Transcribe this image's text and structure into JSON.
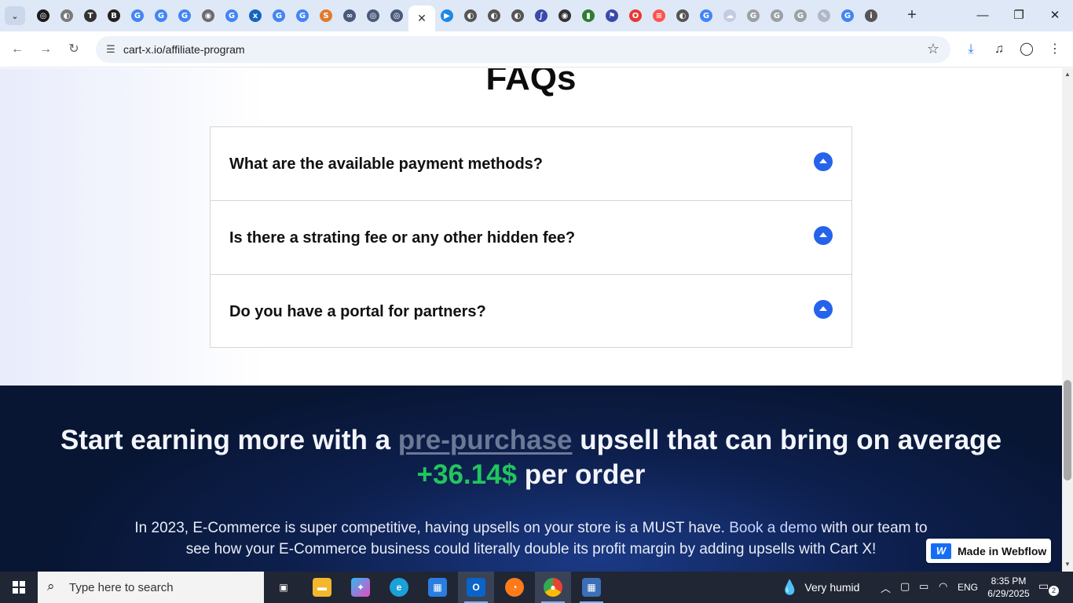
{
  "browser": {
    "url": "cart-x.io/affiliate-program",
    "tabs": [
      {
        "icon": "openai-icon",
        "color": "#1a1a1a",
        "glyph": "◎"
      },
      {
        "icon": "globe-icon",
        "color": "#7a7a7a",
        "glyph": "◐"
      },
      {
        "icon": "ttp-icon",
        "color": "#333333",
        "glyph": "T"
      },
      {
        "icon": "b-icon",
        "color": "#222222",
        "glyph": "B"
      },
      {
        "icon": "google-icon",
        "color": "#4285f4",
        "glyph": "G"
      },
      {
        "icon": "google-icon",
        "color": "#4285f4",
        "glyph": "G"
      },
      {
        "icon": "google-icon",
        "color": "#4285f4",
        "glyph": "G"
      },
      {
        "icon": "globe-icon",
        "color": "#6b6b6b",
        "glyph": "◉"
      },
      {
        "icon": "google-icon",
        "color": "#4285f4",
        "glyph": "G"
      },
      {
        "icon": "xf-icon",
        "color": "#1565c0",
        "glyph": "x"
      },
      {
        "icon": "google-icon",
        "color": "#4285f4",
        "glyph": "G"
      },
      {
        "icon": "google-icon",
        "color": "#4285f4",
        "glyph": "G"
      },
      {
        "icon": "swirl-icon",
        "color": "#e07a2e",
        "glyph": "S"
      },
      {
        "icon": "link-icon",
        "color": "#4a5a7a",
        "glyph": "∞"
      },
      {
        "icon": "openai-icon",
        "color": "#4a5a7a",
        "glyph": "◎"
      },
      {
        "icon": "openai-icon",
        "color": "#4a5a7a",
        "glyph": "◎"
      }
    ],
    "tabs_right": [
      {
        "icon": "play-store-icon",
        "color": "#1e88e5",
        "glyph": "▶"
      },
      {
        "icon": "globe-icon",
        "color": "#555555",
        "glyph": "◐"
      },
      {
        "icon": "globe-icon",
        "color": "#555555",
        "glyph": "◐"
      },
      {
        "icon": "globe-icon",
        "color": "#555555",
        "glyph": "◐"
      },
      {
        "icon": "chart-icon",
        "color": "#3949ab",
        "glyph": "∫"
      },
      {
        "icon": "target-icon",
        "color": "#333333",
        "glyph": "◉"
      },
      {
        "icon": "bars-icon",
        "color": "#2e7d32",
        "glyph": "▮"
      },
      {
        "icon": "flag-icon",
        "color": "#3949ab",
        "glyph": "⚑"
      },
      {
        "icon": "opera-icon",
        "color": "#e53935",
        "glyph": "O"
      },
      {
        "icon": "stripes-icon",
        "color": "#ff5252",
        "glyph": "≡"
      },
      {
        "icon": "globe-icon",
        "color": "#555555",
        "glyph": "◐"
      },
      {
        "icon": "google-icon",
        "color": "#4285f4",
        "glyph": "G"
      },
      {
        "icon": "cloud-icon",
        "color": "#c5cbe0",
        "glyph": "☁"
      },
      {
        "icon": "google-icon",
        "color": "#9aa0a6",
        "glyph": "G"
      },
      {
        "icon": "google-icon",
        "color": "#9aa0a6",
        "glyph": "G"
      },
      {
        "icon": "google-icon",
        "color": "#9aa0a6",
        "glyph": "G"
      },
      {
        "icon": "pen-icon",
        "color": "#b0b8c8",
        "glyph": "✎"
      },
      {
        "icon": "google-icon",
        "color": "#4285f4",
        "glyph": "G"
      },
      {
        "icon": "info-icon",
        "color": "#555555",
        "glyph": "i"
      }
    ]
  },
  "faq": {
    "title": "FAQs",
    "items": [
      {
        "question": "What are the available payment methods?"
      },
      {
        "question": "Is there a strating fee or any other hidden fee?"
      },
      {
        "question": "Do you have a portal for partners?"
      }
    ]
  },
  "cta": {
    "heading_before": "Start earning more with a ",
    "heading_link": "pre-purchase",
    "heading_after": " upsell that can bring on average ",
    "heading_amount": "+36.14$",
    "heading_end": " per order",
    "text_before": "In 2023, E-Commerce is super competitive, having upsells on your store is a MUST have. ",
    "text_demo": "Book a demo",
    "text_after": " with our team to see how your E-Commerce business could literally double its profit margin by adding upsells with Cart X!"
  },
  "badge": {
    "label": "Made in Webflow"
  },
  "taskbar": {
    "search_placeholder": "Type here to search",
    "weather": "Very humid",
    "lang": "ENG",
    "time": "8:35 PM",
    "date": "6/29/2025",
    "notifications": "2"
  },
  "colors": {
    "accent": "#2563eb",
    "green": "#22c55e",
    "navy": "#0d1f4d"
  }
}
